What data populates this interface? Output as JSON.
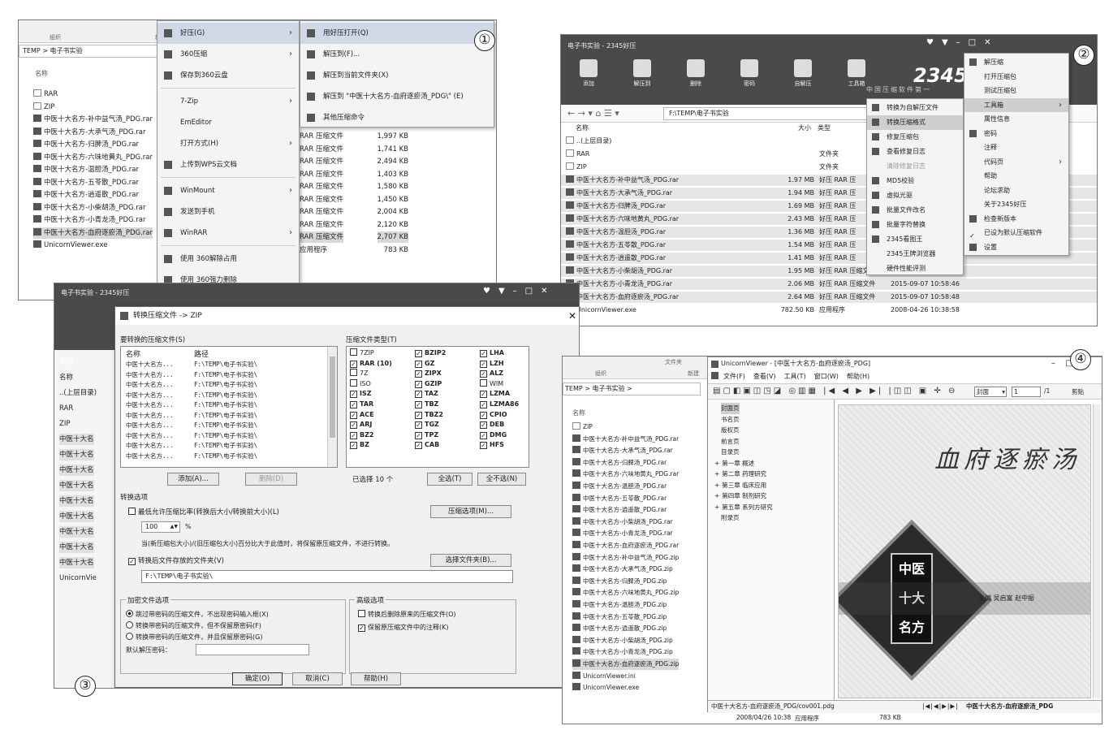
{
  "markers": [
    "①",
    "②",
    "③",
    "④"
  ],
  "s1": {
    "col_header_left": "组织",
    "col_header_mid": "新建",
    "path": "TEMP > 电子书实验",
    "name_header": "名称",
    "files": [
      "RAR",
      "ZIP",
      "中医十大名方-补中益气汤_PDG.rar",
      "中医十大名方-大承气汤_PDG.rar",
      "中医十大名方-归脾汤_PDG.rar",
      "中医十大名方-六味地黄丸_PDG.rar",
      "中医十大名方-温胆汤_PDG.rar",
      "中医十大名方-五苓散_PDG.rar",
      "中医十大名方-逍遥散_PDG.rar",
      "中医十大名方-小柴胡汤_PDG.rar",
      "中医十大名方-小青龙汤_PDG.rar",
      "中医十大名方-血府逐瘀汤_PDG.rar",
      "UnicornViewer.exe"
    ],
    "ctx_menu": [
      "好压(G)",
      "360压缩",
      "保存到360云盘",
      "7-Zip",
      "EmEditor",
      "打开方式(H)",
      "上传到WPS云文档",
      "WinMount",
      "发送到手机",
      "WinRAR",
      "使用 360解除占用",
      "使用 360强力删除"
    ],
    "sub_menu": [
      "用好压打开(Q)",
      "解压到(F)...",
      "解压到当前文件夹(X)",
      "解压到 \"中医十大名方-血府逐瘀汤_PDG\\\" (E)",
      "其他压缩命令"
    ],
    "types": [
      "RAR 压缩文件",
      "RAR 压缩文件",
      "RAR 压缩文件",
      "RAR 压缩文件",
      "RAR 压缩文件",
      "RAR 压缩文件",
      "RAR 压缩文件",
      "RAR 压缩文件",
      "RAR 压缩文件",
      "应用程序"
    ],
    "sizes": [
      "1,997 KB",
      "1,741 KB",
      "2,494 KB",
      "1,403 KB",
      "1,580 KB",
      "1,450 KB",
      "2,004 KB",
      "2,120 KB",
      "2,707 KB",
      "783 KB"
    ]
  },
  "s2": {
    "title": "电子书实验 - 2345好压",
    "toolbar": [
      "添加",
      "解压到",
      "删除",
      "密码",
      "自解压",
      "工具箱"
    ],
    "brand": "2345好压",
    "slogan": "中国压缩软件第一",
    "path": "F:\\TEMP\\电子书实验",
    "headers": {
      "name": "名称",
      "size": "大小",
      "type": "类型"
    },
    "rows": [
      {
        "n": "..(上层目录)",
        "s": "",
        "t": "",
        "d": ""
      },
      {
        "n": "RAR",
        "s": "",
        "t": "文件夹",
        "d": ""
      },
      {
        "n": "ZIP",
        "s": "",
        "t": "文件夹",
        "d": ""
      },
      {
        "n": "中医十大名方-补中益气汤_PDG.rar",
        "s": "1.97 MB",
        "t": "好压 RAR 压",
        "d": ""
      },
      {
        "n": "中医十大名方-大承气汤_PDG.rar",
        "s": "1.94 MB",
        "t": "好压 RAR 压",
        "d": ""
      },
      {
        "n": "中医十大名方-归脾汤_PDG.rar",
        "s": "1.69 MB",
        "t": "好压 RAR 压",
        "d": ""
      },
      {
        "n": "中医十大名方-六味地黄丸_PDG.rar",
        "s": "2.43 MB",
        "t": "好压 RAR 压",
        "d": ""
      },
      {
        "n": "中医十大名方-温胆汤_PDG.rar",
        "s": "1.36 MB",
        "t": "好压 RAR 压",
        "d": ""
      },
      {
        "n": "中医十大名方-五苓散_PDG.rar",
        "s": "1.54 MB",
        "t": "好压 RAR 压",
        "d": ""
      },
      {
        "n": "中医十大名方-逍遥散_PDG.rar",
        "s": "1.41 MB",
        "t": "好压 RAR 压",
        "d": "10:58:44"
      },
      {
        "n": "中医十大名方-小柴胡汤_PDG.rar",
        "s": "1.95 MB",
        "t": "好压 RAR 压缩文件",
        "d": "2015-09-07 10:58:45"
      },
      {
        "n": "中医十大名方-小青龙汤_PDG.rar",
        "s": "2.06 MB",
        "t": "好压 RAR 压缩文件",
        "d": "2015-09-07 10:58:46"
      },
      {
        "n": "中医十大名方-血府逐瘀汤_PDG.rar",
        "s": "2.64 MB",
        "t": "好压 RAR 压缩文件",
        "d": "2015-09-07 10:58:48"
      },
      {
        "n": "UnicornViewer.exe",
        "s": "782.50 KB",
        "t": "应用程序",
        "d": "2008-04-26 10:38:58"
      }
    ],
    "tool_menu": [
      "转换为自解压文件",
      "转换压缩格式",
      "修复压缩包",
      "查看修复日志",
      "清除修复日志",
      "MD5校验",
      "虚拟光驱",
      "批量文件改名",
      "批量字符替换",
      "2345看图王",
      "2345王牌浏览器",
      "硬件性能评测"
    ],
    "main_menu": [
      "解压缩",
      "打开压缩包",
      "测试压缩包",
      "工具箱",
      "属性信息",
      "密码",
      "注释",
      "代码页",
      "帮助",
      "论坛求助",
      "关于2345好压",
      "检查新版本",
      "已设为默认压缩软件",
      "设置"
    ]
  },
  "s3": {
    "title": "电子书实验 - 2345好压",
    "dialog_title": "转换压缩文件 -> ZIP",
    "list_label": "要转换的压缩文件(S)",
    "list_headers": [
      "名称",
      "路径"
    ],
    "list_names": [
      "中医十大名方...",
      "中医十大名方...",
      "中医十大名方...",
      "中医十大名方...",
      "中医十大名方...",
      "中医十大名方...",
      "中医十大名方...",
      "中医十大名方...",
      "中医十大名方...",
      "中医十大名方..."
    ],
    "list_path": "F:\\TEMP\\电子书实验\\",
    "types_label": "压缩文件类型(T)",
    "types": [
      [
        "7ZIP",
        "RAR (10)",
        "7Z",
        "ISO",
        "ISZ",
        "TAR",
        "ACE",
        "ARJ",
        "BZ2",
        "BZ"
      ],
      [
        "BZIP2",
        "GZ",
        "ZIPX",
        "GZIP",
        "TAZ",
        "TBZ",
        "TBZ2",
        "TGZ",
        "TPZ",
        "CAB"
      ],
      [
        "LHA",
        "LZH",
        "ALZ",
        "WIM",
        "LZMA",
        "LZMA86",
        "CPIO",
        "DEB",
        "DMG",
        "HFS"
      ]
    ],
    "add_btn": "添加(A)...",
    "del_btn": "删除(D)",
    "selected": "已选择 10 个",
    "all_btn": "全选(T)",
    "none_btn": "全不选(N)",
    "opt_label": "转换选项",
    "ratio": "最低允许压缩比率(转换后大小/转换前大小)(L)",
    "ratio_val": "100",
    "pct": "%",
    "compress_btn": "压缩选项(M)...",
    "note": "当(新压缩包大小)/(旧压缩包大小)百分比大于此值时，将保留原压缩文件，不进行转换。",
    "folder_label": "转换后文件存放的文件夹(V)",
    "folder_btn": "选择文件夹(B)...",
    "folder_val": "F:\\TEMP\\电子书实验\\",
    "enc_label": "加密文件选项",
    "enc_opts": [
      "跳过带密码的压缩文件，不出现密码输入框(X)",
      "转换带密码的压缩文件，但不保留原密码(F)",
      "转换带密码的压缩文件，并且保留原密码(G)"
    ],
    "default_pw": "默认解压密码：",
    "adv_label": "高级选项",
    "adv_opts": [
      "转换后删除原来的压缩文件(O)",
      "保留原压缩文件中的注释(K)"
    ],
    "ok": "确定(O)",
    "cancel": "取消(C)",
    "help": "帮助(H)",
    "left_items": [
      "添加",
      "名称",
      "..(上层目录)",
      "RAR",
      "ZIP",
      "中医十大名",
      "中医十大名",
      "中医十大名",
      "中医十大名",
      "中医十大名",
      "中医十大名",
      "中医十大名",
      "中医十大名",
      "中医十大名",
      "UnicornVie"
    ]
  },
  "s4": {
    "col_left": "组织",
    "col_mid": "新建",
    "col_top": "文件夹",
    "path": "TEMP > 电子书实验 >",
    "name_header": "名称",
    "files": [
      "ZIP",
      "中医十大名方-补中益气汤_PDG.rar",
      "中医十大名方-大承气汤_PDG.rar",
      "中医十大名方-归脾汤_PDG.rar",
      "中医十大名方-六味地黄丸_PDG.rar",
      "中医十大名方-温胆汤_PDG.rar",
      "中医十大名方-五苓散_PDG.rar",
      "中医十大名方-逍遥散_PDG.rar",
      "中医十大名方-小柴胡汤_PDG.rar",
      "中医十大名方-小青龙汤_PDG.rar",
      "中医十大名方-血府逐瘀汤_PDG.rar",
      "中医十大名方-补中益气汤_PDG.zip",
      "中医十大名方-大承气汤_PDG.zip",
      "中医十大名方-归脾汤_PDG.zip",
      "中医十大名方-六味地黄丸_PDG.zip",
      "中医十大名方-温胆汤_PDG.zip",
      "中医十大名方-五苓散_PDG.zip",
      "中医十大名方-逍遥散_PDG.zip",
      "中医十大名方-小柴胡汤_PDG.zip",
      "中医十大名方-小青龙汤_PDG.zip",
      "中医十大名方-血府逐瘀汤_PDG.zip",
      "UnicornViewer.ini",
      "UnicornViewer.exe"
    ],
    "footer_date": "2008/04/26 10:38",
    "footer_type": "应用程序",
    "footer_size": "783 KB",
    "viewer_title": "UnicornViewer - [中医十大名方-血府逐瘀汤_PDG]",
    "menus": [
      "文件(F)",
      "查看(V)",
      "工具(T)",
      "窗口(W)",
      "帮助(H)"
    ],
    "zoom": "封面",
    "page": "1",
    "page_total": "/1",
    "toolbar_right": "剪贴",
    "toc": [
      "封面页",
      "书名页",
      "版权页",
      "前言页",
      "目录页",
      "第一章 概述",
      "第二章 药理研究",
      "第三章 临床应用",
      "第四章 制剂研究",
      "第五章 系列方研究",
      "附录页"
    ],
    "book_title": "血府逐瘀汤",
    "book_series": [
      "中医",
      "十大",
      "名方"
    ],
    "book_authors": "主编  吴启富  赵中振",
    "status_path": "中医十大名方-血府逐瘀汤_PDG/cov001.pdg",
    "status_right": "中医十大名方-血府逐瘀汤_PDG"
  }
}
